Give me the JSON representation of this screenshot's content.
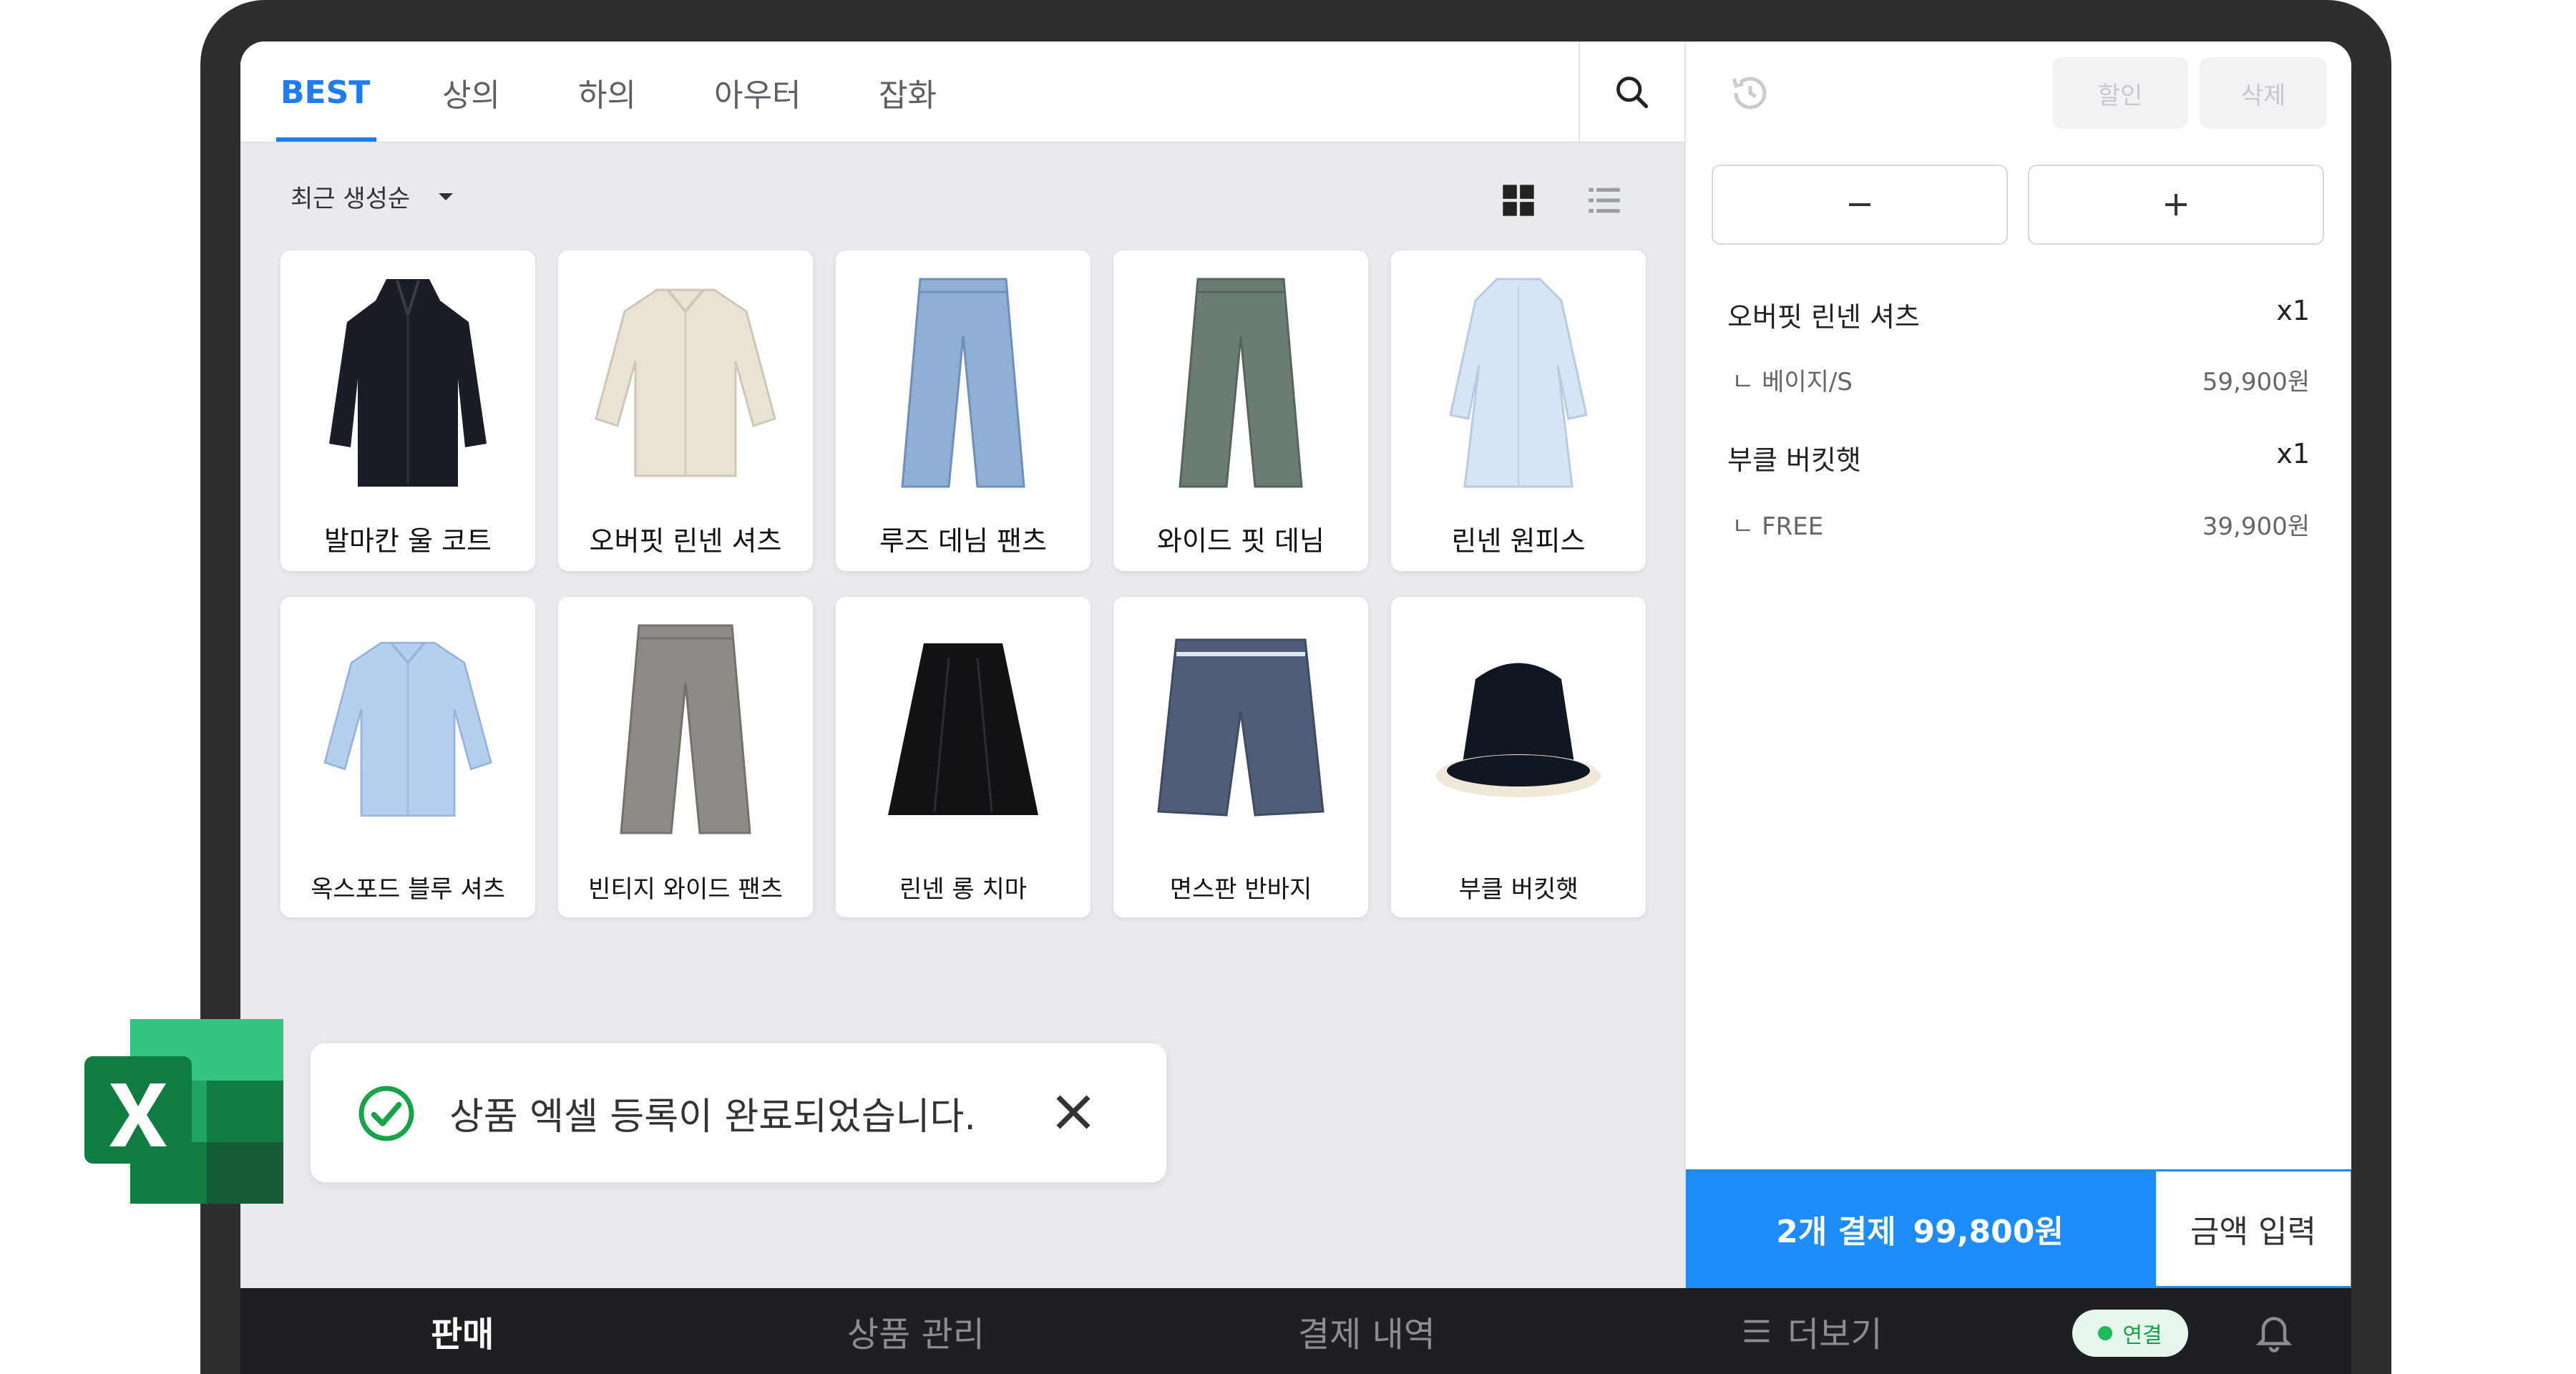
{
  "tabs": [
    {
      "label": "BEST",
      "active": true
    },
    {
      "label": "상의"
    },
    {
      "label": "하의"
    },
    {
      "label": "아우터"
    },
    {
      "label": "잡화"
    }
  ],
  "sort": {
    "label": "최근 생성순"
  },
  "products": [
    {
      "name": "발마칸 울 코트",
      "icon": "coat"
    },
    {
      "name": "오버핏 린넨 셔츠",
      "icon": "shirt-beige"
    },
    {
      "name": "루즈 데님 팬츠",
      "icon": "jeans-light"
    },
    {
      "name": "와이드 핏 데님",
      "icon": "jeans-green"
    },
    {
      "name": "린넨 원피스",
      "icon": "dress"
    },
    {
      "name": "옥스포드 블루 셔츠",
      "icon": "shirt-blue"
    },
    {
      "name": "빈티지 와이드 팬츠",
      "icon": "pants-grey"
    },
    {
      "name": "린넨 롱 치마",
      "icon": "skirt"
    },
    {
      "name": "면스판 반바지",
      "icon": "shorts"
    },
    {
      "name": "부클 버킷햇",
      "icon": "bucket-hat"
    }
  ],
  "header_right": {
    "discount": "할인",
    "delete": "삭제"
  },
  "cart": [
    {
      "name": "오버핏 린넨 셔츠",
      "qty": "x1",
      "option": "ㄴ 베이지/S",
      "price": "59,900원"
    },
    {
      "name": "부클 버킷햇",
      "qty": "x1",
      "option": "ㄴ FREE",
      "price": "39,900원"
    }
  ],
  "payment": {
    "count_label": "2개 결제",
    "total": "99,800원",
    "amount_input": "금액 입력"
  },
  "bottom_nav": {
    "sell": "판매",
    "products": "상품 관리",
    "history": "결제 내역",
    "more": "더보기"
  },
  "connection": {
    "label": "연결"
  },
  "toast": {
    "message": "상품 엑셀 등록이 완료되었습니다."
  },
  "colors": {
    "accent": "#1d8cf8",
    "tab_active": "#1d7cf2",
    "nav_bg": "#1e1f22",
    "excel_green": "#107c41"
  }
}
